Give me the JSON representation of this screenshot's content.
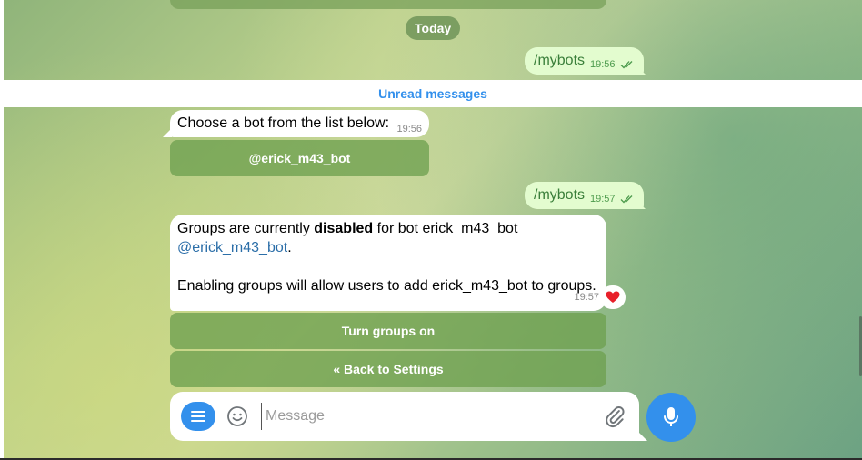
{
  "chat": {
    "date_separator": "Today",
    "unread_label": "Unread messages",
    "messages": [
      {
        "type": "outgoing",
        "text": "/mybots",
        "time": "19:56"
      },
      {
        "type": "incoming",
        "text": "Choose a bot from the list below:",
        "time": "19:56",
        "buttons": [
          "@erick_m43_bot"
        ]
      },
      {
        "type": "outgoing",
        "text": "/mybots",
        "time": "19:57"
      },
      {
        "type": "incoming",
        "line1_pre": "Groups are currently ",
        "line1_bold": "disabled",
        "line1_post": " for bot erick_m43_bot",
        "line2_link": "@erick_m43_bot",
        "line2_post": ".",
        "line3": "Enabling groups will allow users to add erick_m43_bot to groups.",
        "time": "19:57",
        "reaction": "heart",
        "buttons": [
          "Turn groups on",
          "« Back to Settings"
        ]
      }
    ]
  },
  "composer": {
    "placeholder": "Message"
  },
  "icons": {
    "menu": "menu-icon",
    "emoji": "emoji-icon",
    "attach": "paperclip-icon",
    "mic": "microphone-icon",
    "read_receipt": "double-check-icon",
    "reaction": "heart-icon"
  },
  "colors": {
    "accent": "#3390ec",
    "outgoing_bubble": "#e3fccf",
    "outgoing_text": "#3a7f3a",
    "link": "#2b6ea8",
    "reaction": "#e8202a"
  }
}
